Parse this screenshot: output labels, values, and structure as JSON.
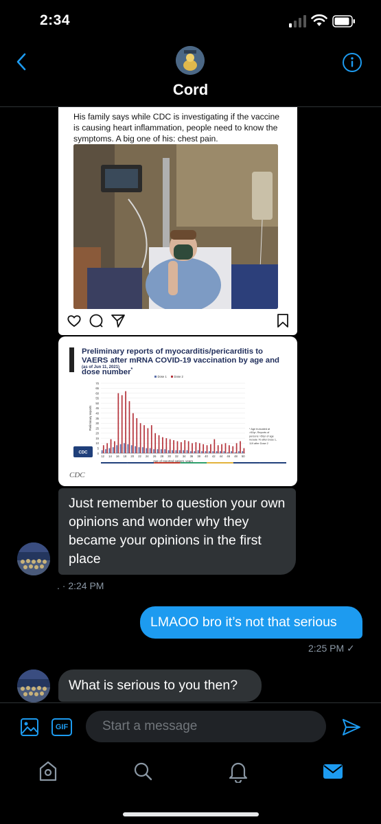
{
  "status_bar": {
    "time": "2:34"
  },
  "header": {
    "contact_name": "Cord"
  },
  "instagram_post": {
    "caption": "His family says while CDC is investigating if the vaccine is causing heart inflammation, people need to know the symptoms. A big one of his: chest pain."
  },
  "cdc_image": {
    "title": "Preliminary reports of myocarditis/pericarditis to VAERS after mRNA COVID-19 vaccination by age and dose number",
    "title_superscript": "*",
    "date_note": "(as of Jun 11, 2021)",
    "source": "CDC",
    "logo_text": "CDC",
    "chart_data": {
      "type": "bar",
      "xlabel": "Age of reported patient, years",
      "ylabel": "Preliminary reports",
      "ylim": [
        0,
        70
      ],
      "y_ticks": [
        0,
        5,
        10,
        15,
        20,
        25,
        30,
        35,
        40,
        45,
        50,
        55,
        60,
        65,
        70
      ],
      "x_tick_labels": [
        "12",
        "14",
        "16",
        "18",
        "20",
        "22",
        "24",
        "26",
        "28",
        "30",
        "32",
        "34",
        "36",
        "38",
        "40",
        "42",
        "44",
        "46",
        "48",
        "50"
      ],
      "categories": [
        12,
        13,
        14,
        15,
        16,
        17,
        18,
        19,
        20,
        21,
        22,
        23,
        24,
        25,
        26,
        27,
        28,
        29,
        30,
        31,
        32,
        33,
        34,
        35,
        36,
        37,
        38,
        39,
        40,
        41,
        42,
        43,
        44,
        45,
        46,
        47,
        48,
        49,
        50
      ],
      "series": [
        {
          "name": "Dose 1",
          "color": "#5b6fa8",
          "values": [
            3,
            4,
            5,
            6,
            8,
            9,
            10,
            9,
            8,
            7,
            6,
            6,
            5,
            5,
            4,
            4,
            4,
            4,
            3,
            3,
            3,
            3,
            3,
            3,
            2,
            2,
            3,
            2,
            2,
            2,
            2,
            2,
            2,
            2,
            1,
            2,
            1,
            2,
            2
          ]
        },
        {
          "name": "Dose 2",
          "color": "#b5343c",
          "values": [
            8,
            10,
            14,
            12,
            60,
            58,
            62,
            52,
            40,
            35,
            30,
            28,
            25,
            28,
            20,
            18,
            16,
            15,
            14,
            13,
            12,
            11,
            13,
            12,
            10,
            11,
            10,
            9,
            8,
            9,
            14,
            8,
            9,
            10,
            8,
            7,
            10,
            12,
            5
          ]
        }
      ],
      "footnote": "* Age truncated at >50yr; Reports of persons >50yr of age include 70 after Dose 1, 119 after Dose 2",
      "legend": "top"
    }
  },
  "messages": [
    {
      "direction": "incoming",
      "text": "Just remember to question your own opinions and wonder why they became your opinions in the first place"
    },
    {
      "direction": "outgoing",
      "text": "LMAOO bro it’s not that serious"
    },
    {
      "direction": "incoming",
      "text": "What is serious to you then?"
    }
  ],
  "timestamps": {
    "first": ". · 2:24 PM",
    "second": "2:25 PM ✓"
  },
  "composer": {
    "placeholder": "Start a message",
    "gif_label": "GIF"
  },
  "colors": {
    "accent": "#1d9bf0",
    "incoming_bubble": "#2f3336",
    "background": "#000000"
  },
  "icons": {
    "header": [
      "back-chevron-icon",
      "info-icon"
    ],
    "composer": [
      "image-icon",
      "gif-icon",
      "send-icon"
    ],
    "tabs": [
      "home-icon",
      "search-icon",
      "notifications-icon",
      "messages-icon"
    ],
    "instagram": [
      "heart-icon",
      "comment-icon",
      "share-icon",
      "bookmark-icon"
    ]
  }
}
